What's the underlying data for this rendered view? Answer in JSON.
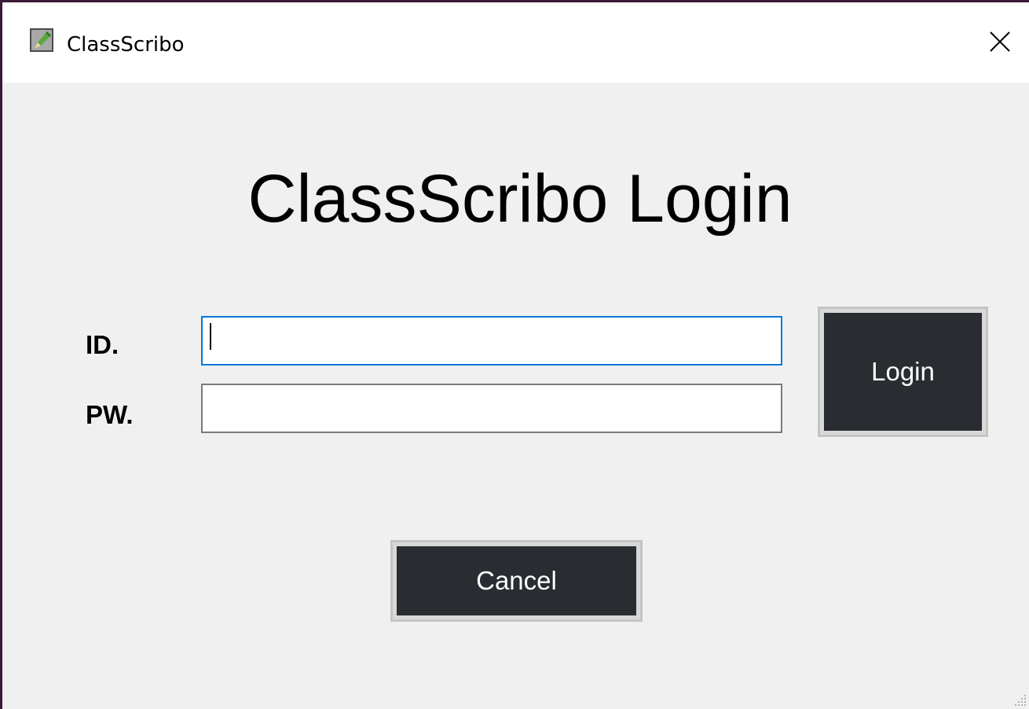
{
  "window": {
    "title": "ClassScribo",
    "app_icon": "pencil-app-icon",
    "close_icon": "close-icon",
    "resize_icon": "resize-grip-icon"
  },
  "login": {
    "heading": "ClassScribo Login",
    "id_label": "ID.",
    "id_value": "",
    "pw_label": "PW.",
    "pw_value": "",
    "login_button": "Login",
    "cancel_button": "Cancel"
  },
  "colors": {
    "button_bg": "#292d31",
    "button_text": "#ffffff",
    "focus_border": "#0078d7",
    "window_bg": "#f0f0f0",
    "titlebar_bg": "#ffffff"
  }
}
